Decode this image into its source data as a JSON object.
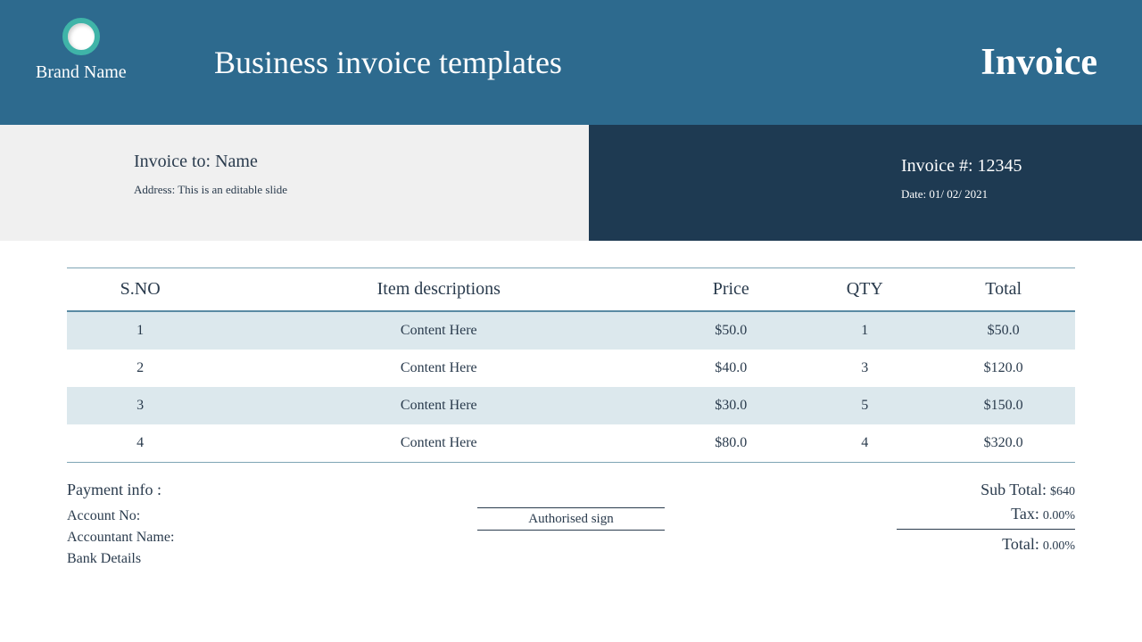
{
  "header": {
    "brand": "Brand Name",
    "title": "Business invoice templates",
    "invoice_word": "Invoice"
  },
  "meta": {
    "to_label": "Invoice to: Name",
    "address": "Address: This is an editable slide",
    "invoice_num_label": "Invoice #:",
    "invoice_num": "12345",
    "date_label": "Date:",
    "date": "01/ 02/ 2021"
  },
  "table": {
    "headers": [
      "S.NO",
      "Item descriptions",
      "Price",
      "QTY",
      "Total"
    ],
    "rows": [
      {
        "sno": "1",
        "desc": "Content Here",
        "price": "$50.0",
        "qty": "1",
        "total": "$50.0"
      },
      {
        "sno": "2",
        "desc": "Content Here",
        "price": "$40.0",
        "qty": "3",
        "total": "$120.0"
      },
      {
        "sno": "3",
        "desc": "Content Here",
        "price": "$30.0",
        "qty": "5",
        "total": "$150.0"
      },
      {
        "sno": "4",
        "desc": "Content Here",
        "price": "$80.0",
        "qty": "4",
        "total": "$320.0"
      }
    ]
  },
  "payment": {
    "heading": "Payment info :",
    "account_no": "Account No:",
    "accountant": "Accountant Name:",
    "bank": "Bank Details"
  },
  "sign": "Authorised sign",
  "totals": {
    "subtotal_label": "Sub Total:",
    "subtotal_value": "$640",
    "tax_label": "Tax:",
    "tax_value": "0.00%",
    "total_label": "Total:",
    "total_value": "0.00%"
  }
}
